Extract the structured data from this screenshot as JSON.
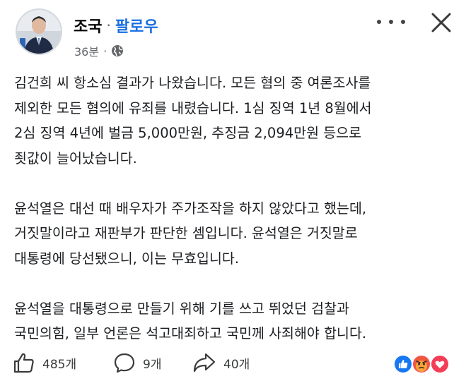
{
  "post": {
    "author": "조국",
    "separator": "·",
    "follow_label": "팔로우",
    "time": "36분",
    "meta_separator": "·",
    "privacy_icon": "globe-icon",
    "avatar_icon": "profile-photo",
    "paragraphs": [
      [
        "김건희 씨 항소심 결과가 나왔습니다. 모든 혐의 중 여론조사를",
        "제외한 모든 혐의에 유죄를 내렸습니다. 1심 징역 1년 8월에서",
        "2심 징역 4년에 벌금 5,000만원, 추징금 2,094만원 등으로",
        "죗값이 늘어났습니다."
      ],
      [
        "윤석열은 대선 때 배우자가 주가조작을 하지 않았다고 했는데,",
        "거짓말이라고 재판부가 판단한 셈입니다. 윤석열은 거짓말로",
        "대통령에 당선됐으니, 이는 무효입니다."
      ],
      [
        "윤석열을 대통령으로 만들기 위해 기를 쓰고 뛰었던 검찰과",
        "국민의힘, 일부 언론은 석고대죄하고 국민께 사죄해야 합니다."
      ]
    ]
  },
  "header": {
    "more_icon": "more-dots-icon",
    "close_icon": "close-icon"
  },
  "actions": {
    "likes": "485개",
    "comments": "9개",
    "shares": "40개"
  },
  "reactions": [
    "like",
    "angry",
    "love"
  ],
  "colors": {
    "follow": "#1b6fe0",
    "like": "#1877f2",
    "angry": "#f25268",
    "love": "#f33e58",
    "text": "#1c1e21",
    "meta": "#65676b"
  }
}
